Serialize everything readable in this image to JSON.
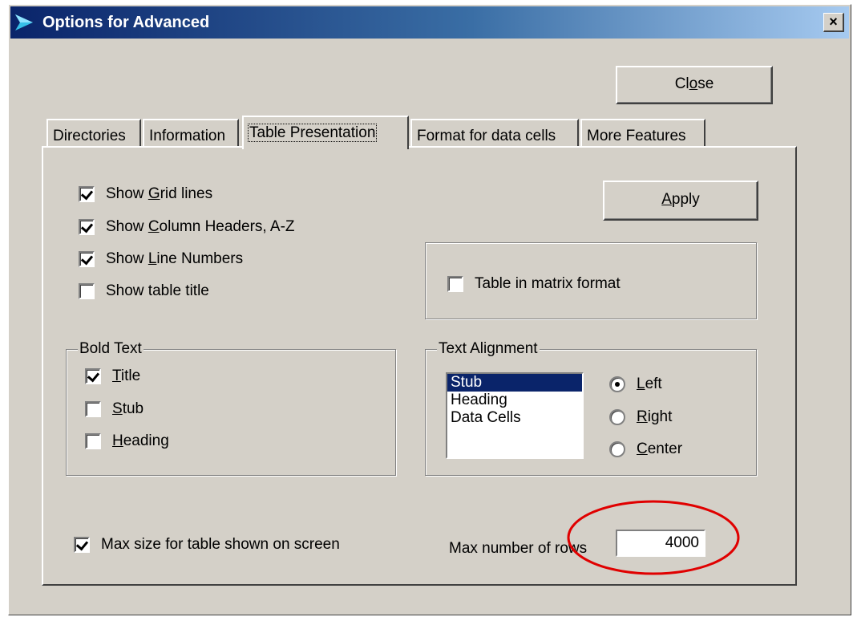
{
  "window": {
    "title": "Options for Advanced",
    "close_glyph": "×",
    "title_icon": "arrow-icon"
  },
  "buttons": {
    "close_pre": "Cl",
    "close_u": "o",
    "close_post": "se",
    "apply_pre": "",
    "apply_u": "A",
    "apply_post": "pply"
  },
  "tabs": [
    {
      "label": "Directories"
    },
    {
      "label": "Information"
    },
    {
      "label": "Table Presentation",
      "active": true
    },
    {
      "label": "Format for data cells"
    },
    {
      "label": "More Features"
    }
  ],
  "options": [
    {
      "pre": "Show ",
      "u": "G",
      "post": "rid lines",
      "checked": true
    },
    {
      "pre": "Show ",
      "u": "C",
      "post": "olumn Headers, A-Z",
      "checked": true
    },
    {
      "pre": "Show ",
      "u": "L",
      "post": "ine Numbers",
      "checked": true
    },
    {
      "pre": "Show table title",
      "u": "",
      "post": "",
      "checked": false
    }
  ],
  "matrix": {
    "label": "Table in matrix format",
    "checked": false
  },
  "bold_text": {
    "title": "Bold Text",
    "items": [
      {
        "u": "T",
        "post": "itle",
        "checked": true
      },
      {
        "u": "S",
        "post": "tub",
        "checked": false
      },
      {
        "u": "H",
        "post": "eading",
        "checked": false
      }
    ]
  },
  "text_alignment": {
    "title": "Text Alignment",
    "list": [
      "Stub",
      "Heading",
      "Data Cells"
    ],
    "selected_index": 0,
    "radios": [
      {
        "u": "L",
        "post": "eft",
        "checked": true
      },
      {
        "u": "R",
        "post": "ight",
        "checked": false
      },
      {
        "u": "C",
        "post": "enter",
        "checked": false
      }
    ]
  },
  "max_size": {
    "label": "Max size for table shown on screen",
    "checked": true
  },
  "max_rows": {
    "label": "Max number of rows",
    "value": "4000"
  },
  "colors": {
    "annotation": "#e00000",
    "titlebar": "#0a246a",
    "selection": "#0a246a"
  }
}
